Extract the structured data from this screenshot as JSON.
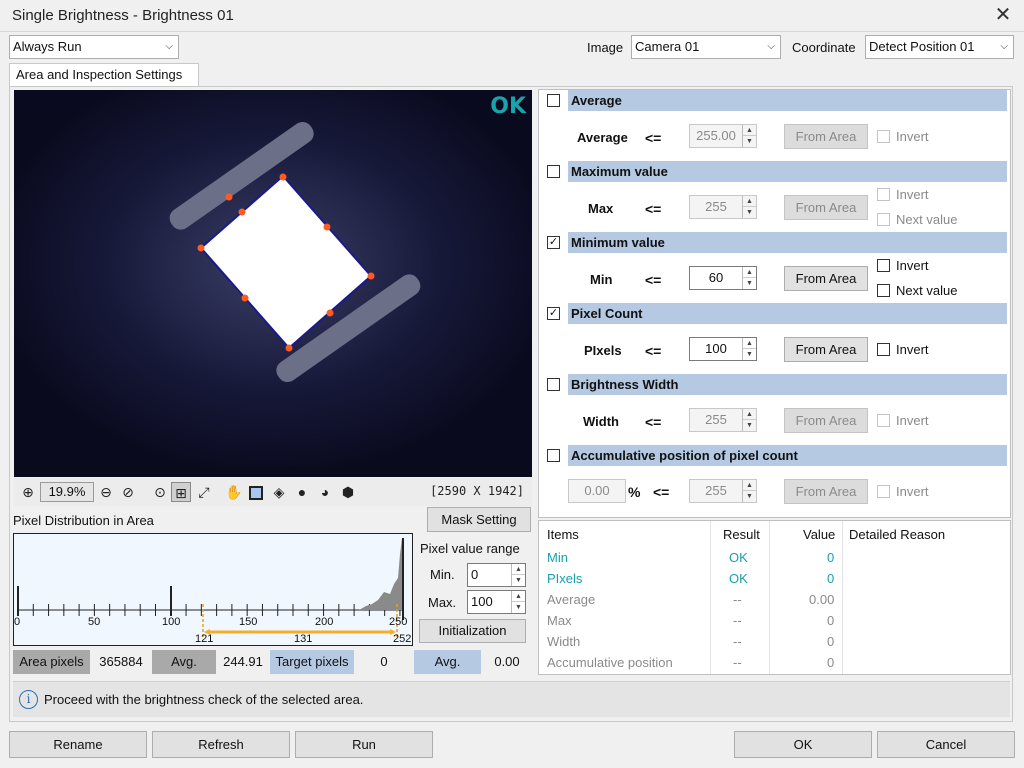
{
  "window": {
    "title": "Single Brightness - Brightness 01"
  },
  "top": {
    "run_mode": "Always Run",
    "image_label": "Image",
    "image_value": "Camera 01",
    "coordinate_label": "Coordinate",
    "coordinate_value": "Detect Position 01"
  },
  "tab": {
    "label": "Area and Inspection Settings"
  },
  "viewer": {
    "status": "OK",
    "zoom": "19.9%",
    "dimensions": "[2590 X 1942]",
    "status_color": "#19a3ad"
  },
  "distribution": {
    "label": "Pixel Distribution in Area",
    "mask_button": "Mask Setting",
    "axis_ticks": [
      "0",
      "50",
      "100",
      "150",
      "200",
      "250"
    ],
    "range_min": "121",
    "range_span": "131",
    "range_max": "252",
    "pixel_value_range_label": "Pixel value range",
    "min_label": "Min.",
    "min_value": "0",
    "max_label": "Max.",
    "max_value": "100",
    "init_button": "Initialization"
  },
  "stats": {
    "area_pixels_label": "Area pixels",
    "area_pixels_value": "365884",
    "avg_label": "Avg.",
    "avg_value": "244.91",
    "target_pixels_label": "Target pixels",
    "target_pixels_value": "0",
    "target_avg_label": "Avg.",
    "target_avg_value": "0.00"
  },
  "info": {
    "message": "Proceed with the brightness check of the selected area."
  },
  "criteria": {
    "from_area": "From Area",
    "invert": "Invert",
    "next_value": "Next value",
    "op": "<=",
    "average": {
      "title": "Average",
      "label": "Average",
      "value": "255.00",
      "checked": false
    },
    "maximum": {
      "title": "Maximum value",
      "label": "Max",
      "value": "255",
      "checked": false
    },
    "minimum": {
      "title": "Minimum value",
      "label": "Min",
      "value": "60",
      "checked": true
    },
    "pixel_count": {
      "title": "Pixel Count",
      "label": "PIxels",
      "value": "100",
      "checked": true
    },
    "width": {
      "title": "Brightness Width",
      "label": "Width",
      "value": "255",
      "checked": false
    },
    "accum": {
      "title": "Accumulative position of pixel count",
      "percent_value": "0.00",
      "percent": "%",
      "value": "255",
      "checked": false
    }
  },
  "results": {
    "headers": {
      "items": "Items",
      "result": "Result",
      "value": "Value",
      "reason": "Detailed Reason"
    },
    "rows": [
      {
        "item": "Min",
        "result": "OK",
        "value": "0",
        "active": true
      },
      {
        "item": "PIxels",
        "result": "OK",
        "value": "0",
        "active": true
      },
      {
        "item": "Average",
        "result": "--",
        "value": "0.00",
        "active": false
      },
      {
        "item": "Max",
        "result": "--",
        "value": "0",
        "active": false
      },
      {
        "item": "Width",
        "result": "--",
        "value": "0",
        "active": false
      },
      {
        "item": "Accumulative position",
        "result": "--",
        "value": "0",
        "active": false
      }
    ]
  },
  "buttons": {
    "rename": "Rename",
    "refresh": "Refresh",
    "run": "Run",
    "ok": "OK",
    "cancel": "Cancel"
  }
}
